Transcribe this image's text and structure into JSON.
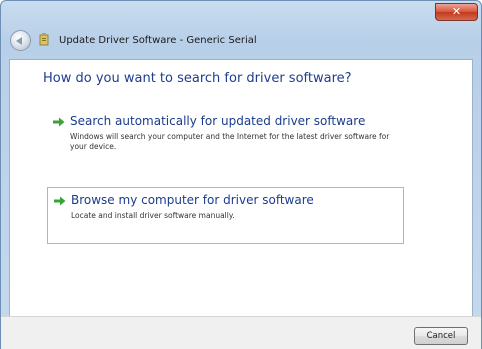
{
  "window": {
    "title": "Update Driver Software - Generic Serial",
    "close_label": "✕"
  },
  "wizard": {
    "heading": "How do you want to search for driver software?",
    "options": [
      {
        "title": "Search automatically for updated driver software",
        "description": "Windows will search your computer and the Internet for the latest driver software for your device.",
        "icon": "green-arrow-icon"
      },
      {
        "title": "Browse my computer for driver software",
        "description": "Locate and install driver software manually.",
        "icon": "green-arrow-icon"
      }
    ]
  },
  "footer": {
    "cancel_label": "Cancel"
  },
  "colors": {
    "heading": "#1e3d8f",
    "option_title": "#1b3c8e",
    "arrow": "#3aa335",
    "selected_border": "#9fc39f",
    "close_button": "#d9573b"
  }
}
